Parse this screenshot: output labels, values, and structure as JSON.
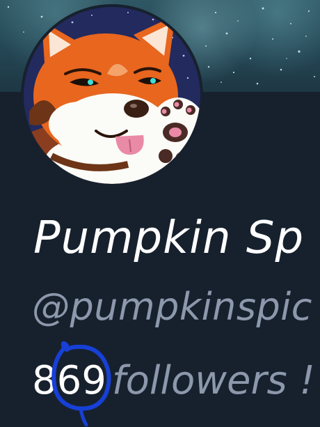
{
  "profile": {
    "display_name": "Pumpkin Sp",
    "handle": "@pumpkinspic",
    "followers_count": "869",
    "followers_label": "followers !",
    "avatar_icon": "fox-avatar",
    "banner_icon": "night-sky-banner"
  },
  "annotation": {
    "shape": "hand-drawn-circle",
    "color": "#1740d6",
    "target": "followers_count"
  },
  "colors": {
    "background": "#17212e",
    "display_name": "#ffffff",
    "secondary_text": "#8c98ab",
    "banner": "#2b4f5d"
  }
}
